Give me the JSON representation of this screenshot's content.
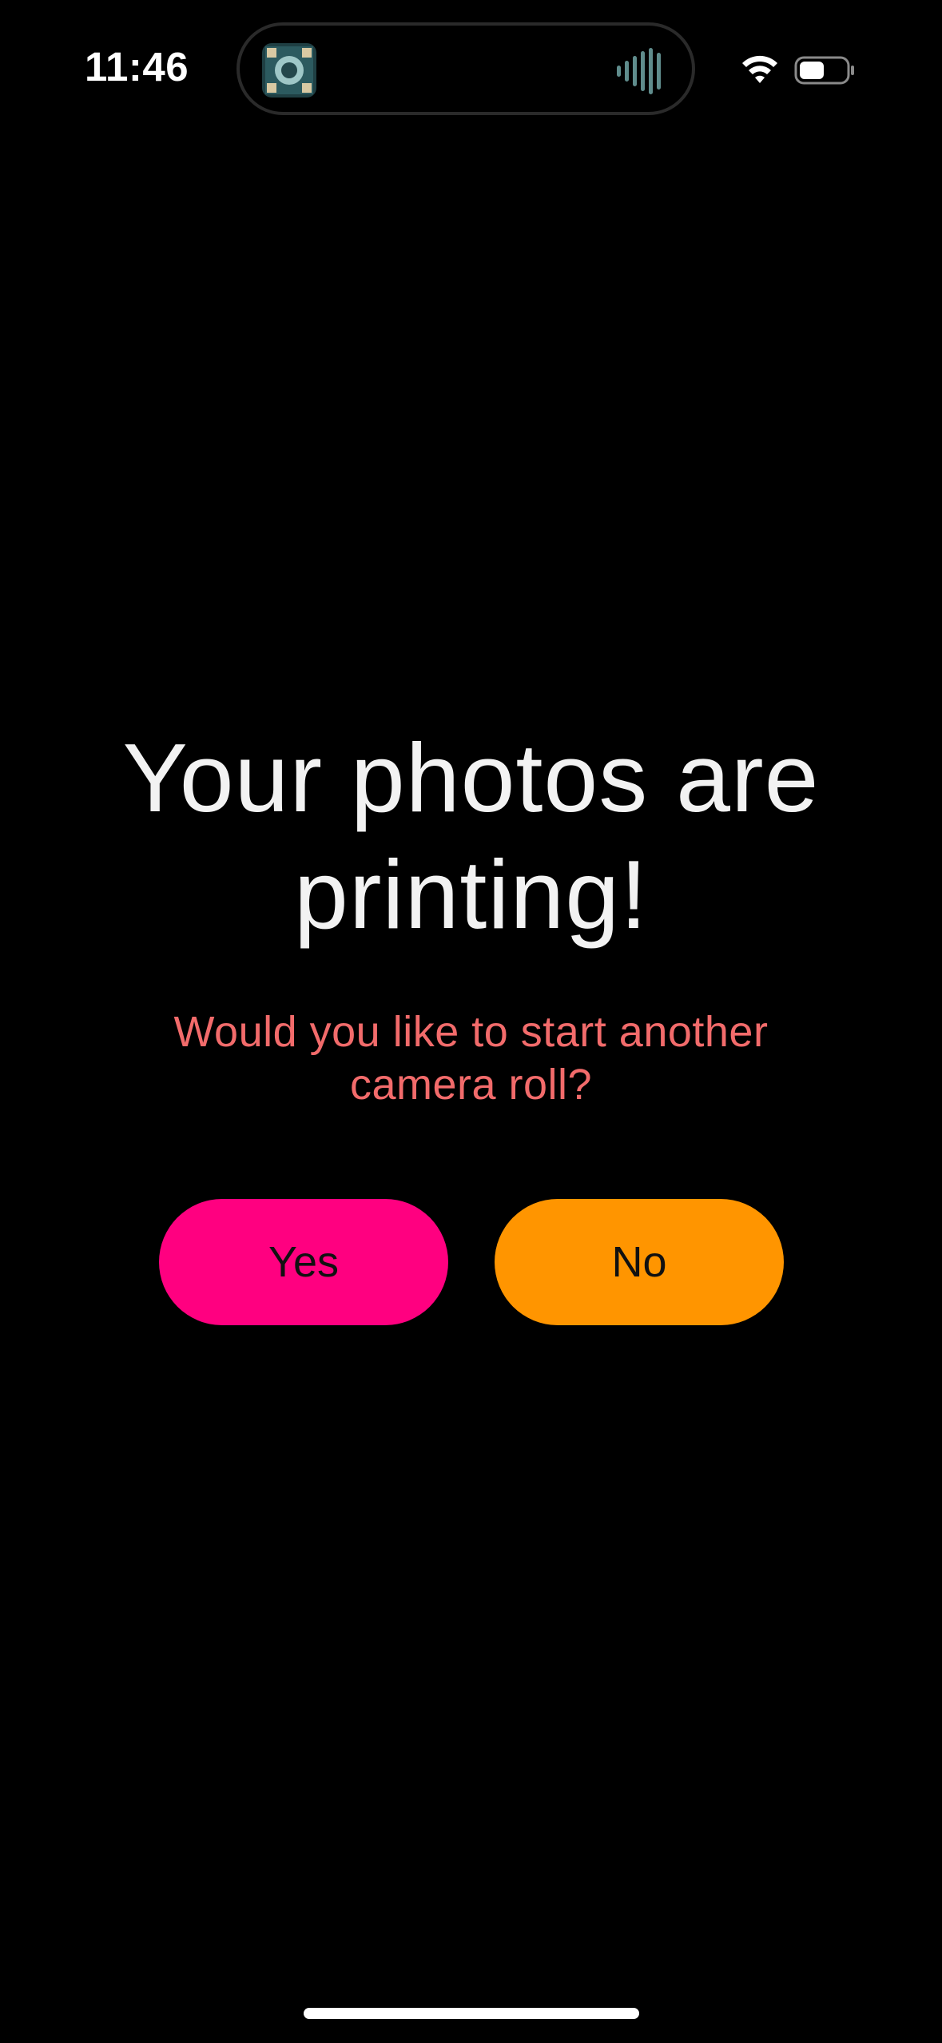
{
  "status_bar": {
    "time": "11:46",
    "wifi_icon": "wifi-icon",
    "battery_icon": "battery-icon",
    "island_app_icon": "app-icon",
    "island_activity_icon": "audio-waveform-icon"
  },
  "main": {
    "headline": "Your photos are printing!",
    "subtitle": "Would you like to start another camera roll?"
  },
  "actions": {
    "yes_label": "Yes",
    "no_label": "No"
  },
  "colors": {
    "background": "#000000",
    "headline": "#f2f2f2",
    "subtitle": "#f26b6b",
    "yes_button": "#ff0080",
    "no_button": "#ff9500"
  }
}
